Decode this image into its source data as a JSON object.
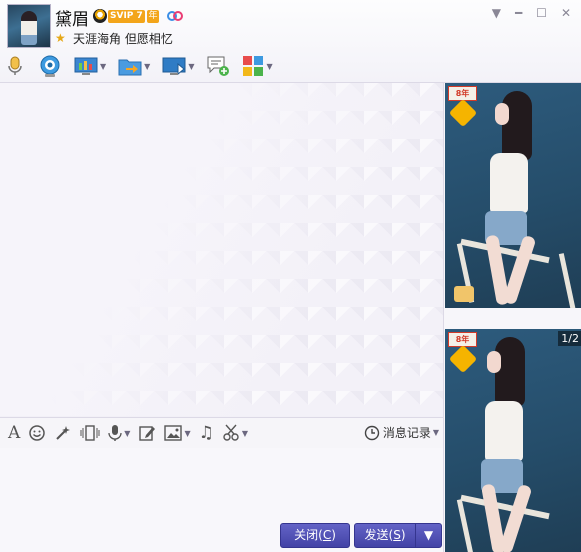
{
  "header": {
    "nickname": "黛眉",
    "vip_label": "SVIP 7",
    "year_label": "年",
    "signature": "天涯海角 但愿相忆"
  },
  "toolbar": {
    "items": [
      "voice-icon",
      "video-icon",
      "screen-share-icon",
      "file-transfer-icon",
      "remote-assist-icon",
      "new-discussion-icon",
      "apps-icon"
    ]
  },
  "input_toolbar": {
    "history_label": "消息记录"
  },
  "buttons": {
    "close_label": "关闭",
    "close_key": "C",
    "send_label": "发送",
    "send_key": "S"
  },
  "side": {
    "badge1": "8年",
    "badge2": "8年",
    "pager": "1/2"
  },
  "colors": {
    "button": "#4d4db0",
    "vip": "#f3a51a",
    "photo_bg": "#2d5b7d"
  }
}
